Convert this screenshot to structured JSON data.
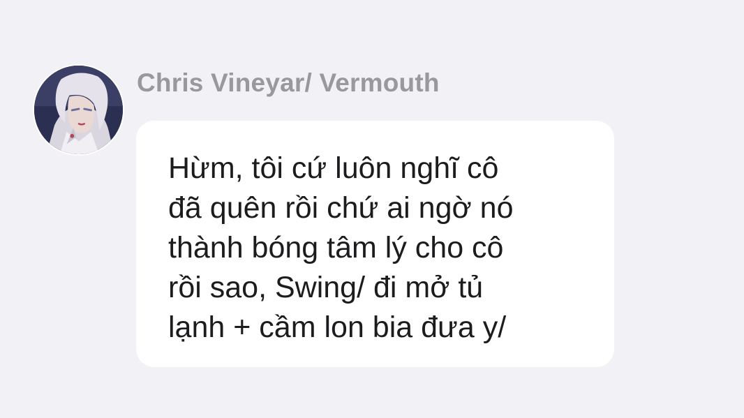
{
  "message": {
    "sender": "Chris Vineyar/ Vermouth",
    "avatar_icon": "character-portrait",
    "lines": [
      "Hừm, tôi cứ luôn nghĩ cô",
      "đã quên rồi chứ ai ngờ nó",
      "thành bóng tâm lý cho cô",
      "rồi sao, Swing/ đi mở tủ",
      "lạnh + cầm lon bia đưa y/"
    ]
  },
  "colors": {
    "background": "#f2f2f6",
    "bubble": "#ffffff",
    "sender": "#98989d",
    "text": "#1c1c1e"
  }
}
